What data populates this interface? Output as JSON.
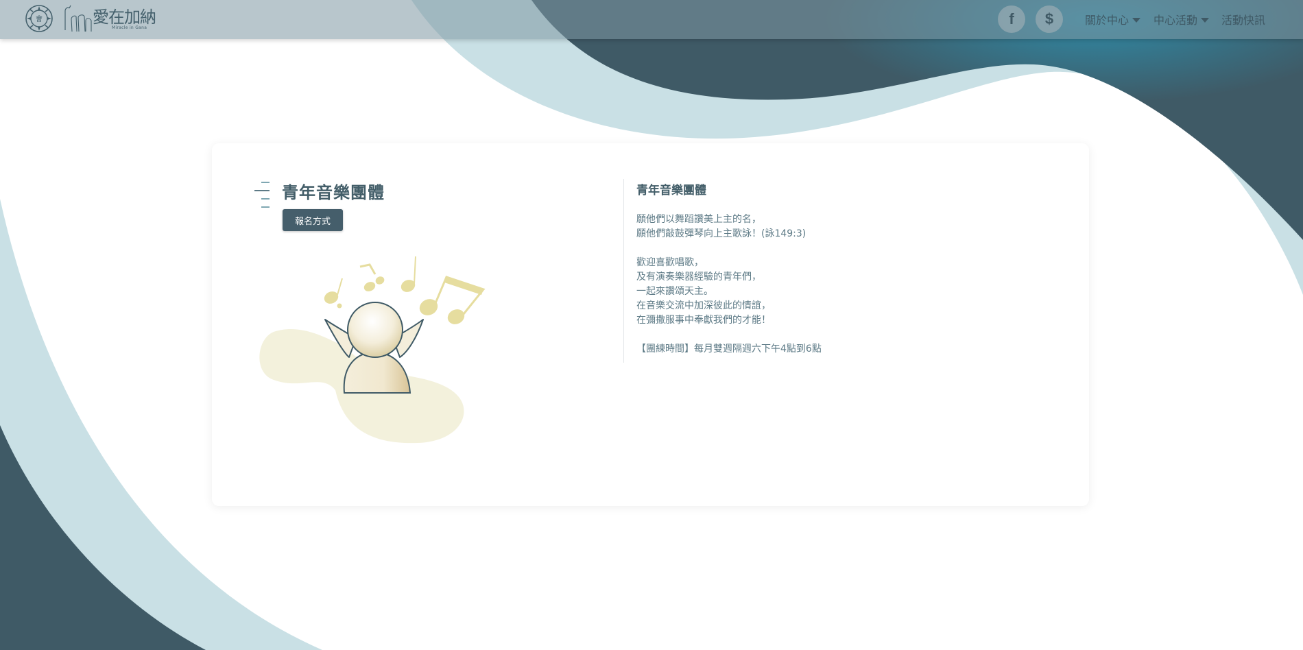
{
  "header": {
    "logo_text": "愛在加納",
    "logo_subtext": "Miracle in Gana",
    "emblem_char": "會",
    "social": {
      "facebook_label": "f",
      "donate_label": "$"
    },
    "nav": [
      {
        "label": "關於中心",
        "has_dropdown": true
      },
      {
        "label": "中心活動",
        "has_dropdown": true
      },
      {
        "label": "活動快訊",
        "has_dropdown": false
      }
    ]
  },
  "card": {
    "title": "青年音樂團體",
    "register_button": "報名方式",
    "description_title": "青年音樂團體",
    "verse": [
      "願他們以舞蹈讚美上主的名，",
      "願他們敲鼓彈琴向上主歌詠！(詠149:3)"
    ],
    "body": [
      "歡迎喜歡唱歌，",
      "及有演奏樂器經驗的青年們，",
      "一起來讚頌天主。",
      "在音樂交流中加深彼此的情誼，",
      "在彌撒服事中奉獻我們的才能！"
    ],
    "schedule": "【團練時間】每月雙週隔週六下午4點到6點"
  },
  "colors": {
    "dark_teal": "#3f5a66",
    "light_teal": "#c9e0e5",
    "button": "#455e6b",
    "illustration_cream": "#f3f1dc",
    "notes": "#e6dd9f"
  }
}
